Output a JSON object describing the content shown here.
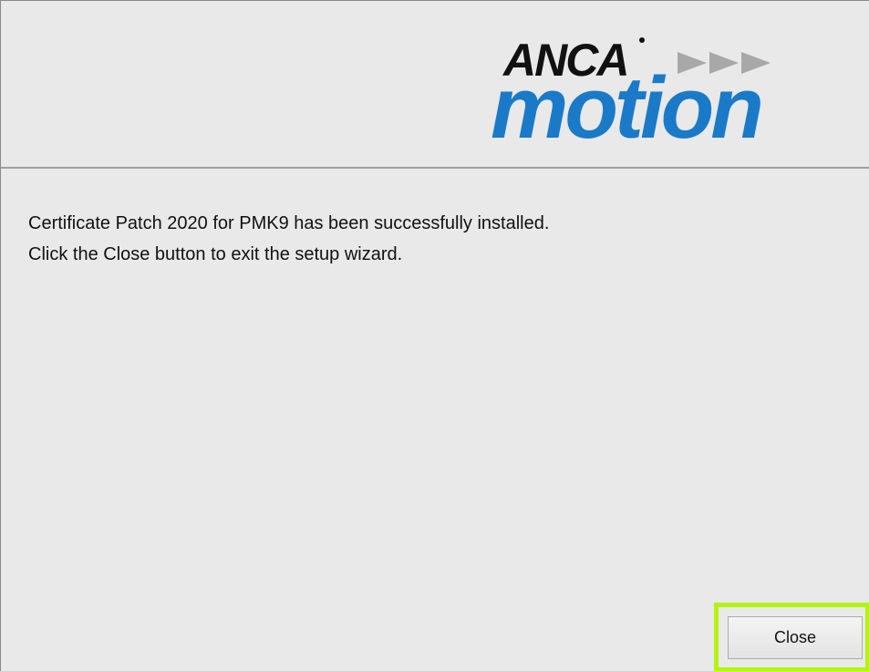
{
  "header": {
    "logo": {
      "brand_top": "ANCA",
      "brand_bottom": "motion",
      "icon": "forward-arrows-icon",
      "colors": {
        "dark": "#111111",
        "blue": "#1a7ac8",
        "gray": "#a8a8a8"
      }
    }
  },
  "message": {
    "line1": "Certificate Patch 2020 for PMK9 has been successfully installed.",
    "line2": "Click the Close button to exit the setup wizard."
  },
  "buttons": {
    "close_label": "Close"
  },
  "highlight": {
    "color": "#b5f314"
  }
}
